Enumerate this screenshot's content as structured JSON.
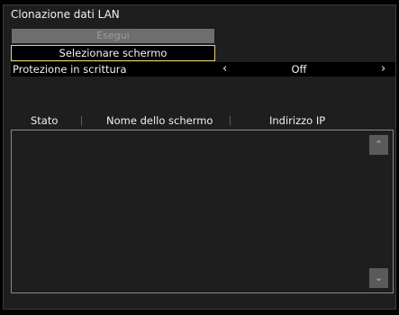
{
  "window": {
    "title": "Clonazione dati LAN"
  },
  "actions": {
    "execute_label": "Esegui",
    "select_screen_label": "Selezionare schermo"
  },
  "write_protection": {
    "label": "Protezione in scrittura",
    "value": "Off",
    "prev_glyph": "‹",
    "next_glyph": "›"
  },
  "table": {
    "columns": [
      "Stato",
      "Nome dello schermo",
      "Indirizzo IP"
    ],
    "rows": []
  },
  "scroll": {
    "up_glyph": "⌃",
    "down_glyph": "⌄"
  },
  "colors": {
    "panel_bg": "#1e1e1e",
    "highlight_border": "#e8d27a",
    "disabled_button_bg": "#6e6e6e"
  }
}
